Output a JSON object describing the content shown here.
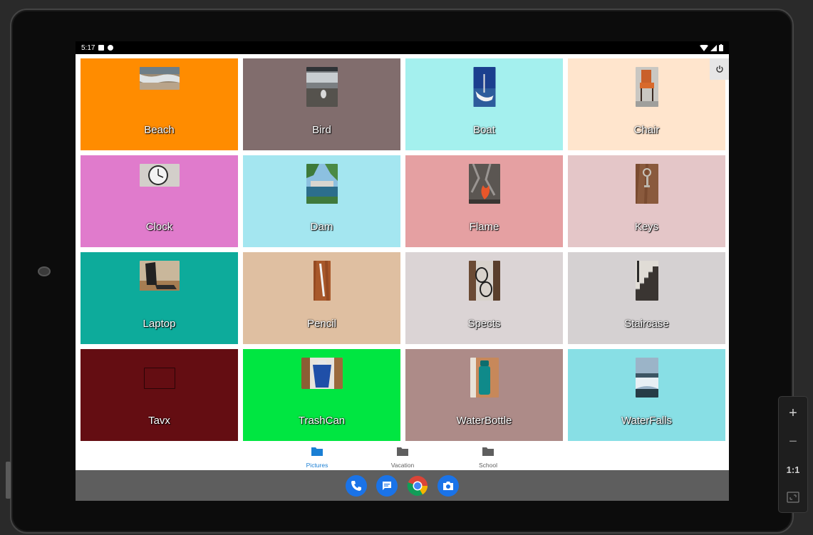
{
  "status_bar": {
    "time": "5:17"
  },
  "tiles": [
    {
      "label": "Beach",
      "bg": "#ff8c00"
    },
    {
      "label": "Bird",
      "bg": "#816d6d"
    },
    {
      "label": "Boat",
      "bg": "#a4f0ee"
    },
    {
      "label": "Chair",
      "bg": "#ffe5cd"
    },
    {
      "label": "Clock",
      "bg": "#e07bcc"
    },
    {
      "label": "Dam",
      "bg": "#a4e6f0"
    },
    {
      "label": "Flame",
      "bg": "#e5a0a2"
    },
    {
      "label": "Keys",
      "bg": "#e4c6c8"
    },
    {
      "label": "Laptop",
      "bg": "#0dab9b"
    },
    {
      "label": "Pencil",
      "bg": "#dfbfa1"
    },
    {
      "label": "Spects",
      "bg": "#dbd4d5"
    },
    {
      "label": "Staircase",
      "bg": "#d5d1d2"
    },
    {
      "label": "Tavx",
      "bg": "#640d12"
    },
    {
      "label": "TrashCan",
      "bg": "#00e641"
    },
    {
      "label": "WaterBottle",
      "bg": "#ad8b88"
    },
    {
      "label": "WaterFalls",
      "bg": "#88dfe5"
    }
  ],
  "bottom_nav": [
    {
      "label": "Pictures",
      "active": true
    },
    {
      "label": "Vacation",
      "active": false
    },
    {
      "label": "School",
      "active": false
    }
  ],
  "colors": {
    "nav_active": "#1a7fd4",
    "nav_inactive": "#5f5f5f"
  },
  "dock_apps": [
    "phone-app",
    "messages-app",
    "chrome-app",
    "camera-app"
  ],
  "emulator_controls": {
    "zoom_in": "+",
    "zoom_out": "−",
    "actual_size": "1:1"
  }
}
